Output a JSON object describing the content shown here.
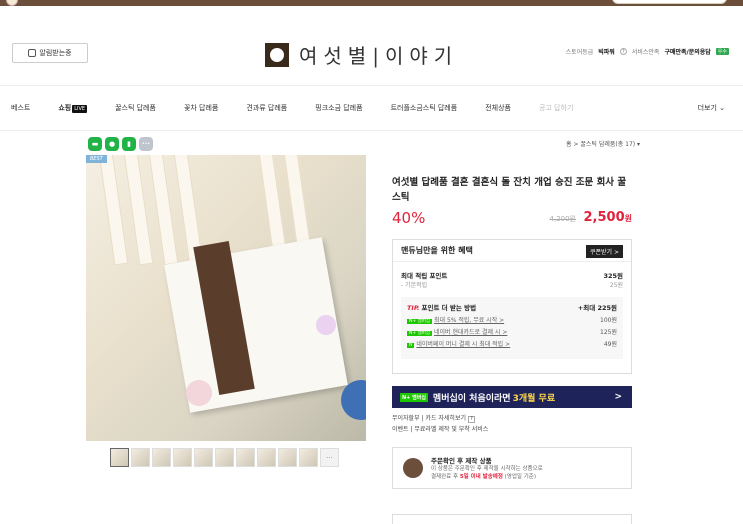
{
  "header": {
    "alarm_label": "알림받는중",
    "brand_name": "여섯별|이야기",
    "right_links": [
      "스토어등급",
      "빅파워",
      "서비스만족"
    ],
    "contact_label": "구매만족/문의응답",
    "contact_badge": "우수"
  },
  "nav": {
    "items": [
      "베스트",
      "쇼핑",
      "꿀스틱 답례품",
      "꽃차 답례품",
      "견과류 답례품",
      "핑크소금 답례품",
      "트러플소금스틱 답례품",
      "전체상품",
      "공고 답하기"
    ],
    "live_badge": "LIVE",
    "more_label": "더보기 ⌄"
  },
  "share": {
    "more": "···"
  },
  "breadcrumb": "홈 > 꿀스틱 답례품(총 17) ▾",
  "photo": {
    "badge": "BEST"
  },
  "product": {
    "title": "여섯별 답례품 결혼 결혼식 돌 잔치 개업 승진 조문 회사 꿀 스틱",
    "discount": "40%",
    "original_price": "4,200원",
    "sale_price": "2,500",
    "sale_unit": "원"
  },
  "benefit": {
    "heading": "맨듀님만을 위한 혜택",
    "coupon_label": "쿠폰받기 >",
    "points_label": "최대 적립 포인트",
    "points_value": "325원",
    "base_label": "- 기본적립",
    "base_value": "25원",
    "tip_label_prefix": "TIP.",
    "tip_label": "포인트 더 받는 방법",
    "tip_value": "+최대 225원",
    "tip_lines": [
      {
        "badge": "N+ 멤버십",
        "text": "최대 5% 적립, 무료 시작 >",
        "value": "100원"
      },
      {
        "badge": "N+ 멤버십",
        "text": "네이버 현대카드로 결제 시 >",
        "value": "125원"
      },
      {
        "badge": "N",
        "text": "네이버페이 머니 결제 시 최대 적립 >",
        "value": "49원"
      }
    ]
  },
  "membership": {
    "badge": "N+ 멤버십",
    "text_before": "멤버십이 처음이라면",
    "highlight": "3개월 무료",
    "arrow": ">"
  },
  "misc": {
    "line1": "무이자할부 | 카드 자세히보기",
    "line2": "이벤트 | 무료라벨 제작 및 부착 서비스"
  },
  "custom": {
    "title": "주문확인 후 제작 상품",
    "desc1": "이 상품은 주문확인 후 제작을 시작하는 상품으로",
    "desc2_before": "결제완료 후",
    "desc2_highlight": "5일 이내 발송예정",
    "desc2_after": "(영업일 기준)"
  }
}
